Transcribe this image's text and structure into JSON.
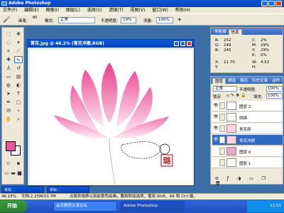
{
  "app": {
    "title": "Adobe Photoshop"
  },
  "menu": {
    "items": [
      "文件(F)",
      "编辑(E)",
      "图像(I)",
      "图层(L)",
      "选择(S)",
      "滤镜(T)",
      "视图(V)",
      "窗口(W)",
      "帮助(H)"
    ]
  },
  "options": {
    "brush_label": "画笔:",
    "brush_size": "80",
    "mode_label": "模式:",
    "mode_value": "正常",
    "opacity_label": "不透明度:",
    "opacity_value": "19%",
    "flow_label": "流量:",
    "flow_value": "100%"
  },
  "document": {
    "title": "青花.jpg @ 46.2% (青花冲擦,RGB)",
    "signature": "璐"
  },
  "navigator": {
    "tabs": [
      "导航器",
      "信息"
    ],
    "info": {
      "r_label": "R:",
      "r_value": "252",
      "c_label": "C:",
      "c_value": "2%",
      "g_label": "G:",
      "g_value": "249",
      "m_label": "M:",
      "m_value": "29%",
      "b_label": "B:",
      "b_value": "245",
      "y_label": "Y:",
      "y_value": "29%",
      "k_label": "K:",
      "k_value": "0%",
      "x_label": "X:",
      "x_value": "11.70",
      "w_label": "W:",
      "w_value": "4.52",
      "y2_label": "Y:",
      "h_label": "H:"
    }
  },
  "layers": {
    "tabs": [
      "图层",
      "通道",
      "路径",
      "历史记录",
      "动作"
    ],
    "blend_mode": "正常",
    "opacity_label": "不透明度:",
    "opacity_value": "100%",
    "fill_label": "填充:",
    "fill_value": "100%",
    "lock_label": "锁定:",
    "rows": [
      {
        "name": "图层 2"
      },
      {
        "name": "线描"
      },
      {
        "name": "青花原"
      },
      {
        "name": "青花冲擦"
      },
      {
        "name": "图层 0"
      },
      {
        "name": "图层 1"
      }
    ]
  },
  "status": {
    "zoom": "46.15%",
    "doc_size": "文档:2.25M/10.7M",
    "hint": "点按并拖移以用前景色绘画。要用附加选项，使用 Shift、Alt 和 Ctrl 键。"
  },
  "mini_windows": [
    "未标...",
    "未标..."
  ],
  "taskbar": {
    "start": "开始",
    "buttons": [
      "会员教程交流论坛",
      "Adobe Photoshop"
    ],
    "clock": "11:01"
  },
  "colors": {
    "foreground": "#e8589a",
    "background": "#ffffff"
  }
}
